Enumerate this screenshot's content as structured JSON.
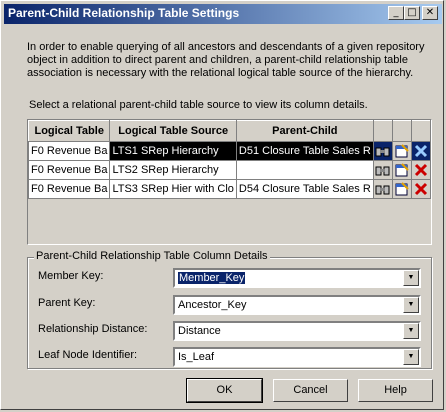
{
  "window": {
    "title": "Parent-Child Relationship Table Settings",
    "controls": {
      "help": "?",
      "close": "✕"
    }
  },
  "description": "In order to enable querying of all ancestors and descendants of a given repository object in addition to direct parent and children, a parent-child relationship table association is necessary with the relational logical table source of the hierarchy.",
  "instruction": "Select a relational parent-child table source to view its column details.",
  "grid": {
    "headers": [
      "Logical Table",
      "Logical Table Source",
      "Parent-Child"
    ],
    "rows": [
      {
        "table": "F0 Revenue Ba",
        "source": "LTS1 SRep Hierarchy",
        "pc": "D51 Closure Table Sales R",
        "selected": true
      },
      {
        "table": "F0 Revenue Ba",
        "source": "LTS2 SRep Hierarchy",
        "pc": "",
        "selected": false
      },
      {
        "table": "F0 Revenue Ba",
        "source": "LTS3 SRep Hier with Clo",
        "pc": "D54 Closure Table Sales R",
        "selected": false
      }
    ]
  },
  "details": {
    "legend": "Parent-Child Relationship Table Column Details",
    "fields": [
      {
        "label": "Member Key:",
        "value": "Member_Key"
      },
      {
        "label": "Parent Key:",
        "value": "Ancestor_Key"
      },
      {
        "label": "Relationship Distance:",
        "value": "Distance"
      },
      {
        "label": "Leaf Node Identifier:",
        "value": "Is_Leaf"
      }
    ]
  },
  "buttons": {
    "ok": "OK",
    "cancel": "Cancel",
    "help": "Help"
  },
  "icons": {
    "select": "browse-icon",
    "edit": "edit-table-icon",
    "remove": "delete-icon"
  },
  "colors": {
    "titlebar_start": "#0a246a",
    "titlebar_end": "#a6caf0",
    "delete": "#cc0000",
    "selection": "#000000"
  }
}
